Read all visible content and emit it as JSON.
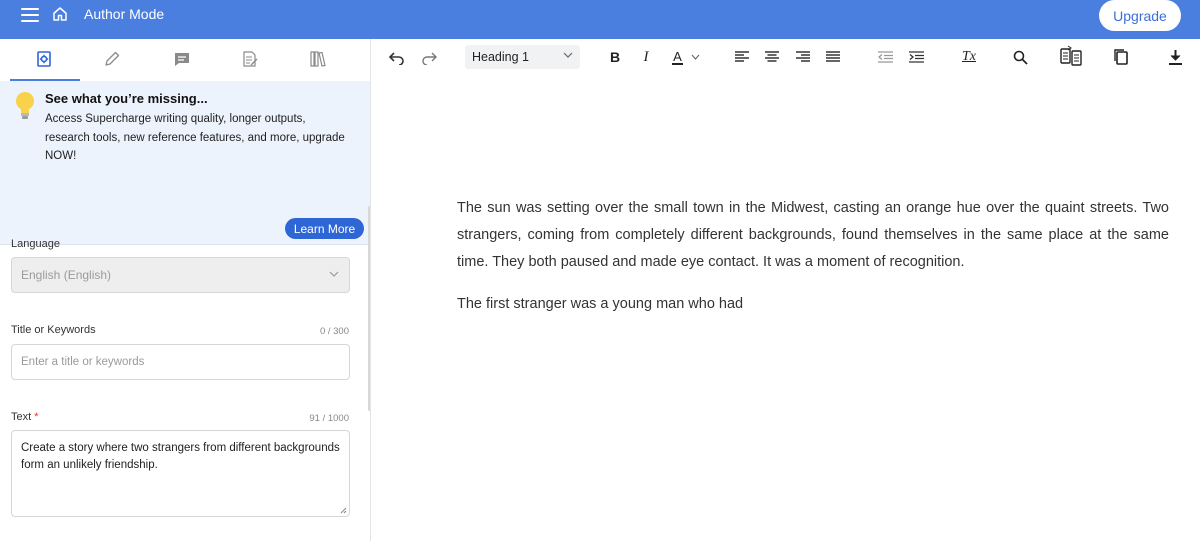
{
  "header": {
    "app_title": "Author Mode",
    "upgrade_label": "Upgrade",
    "bar_color": "#4a7fe0"
  },
  "left_tabs": [
    {
      "icon": "settings-doc-icon"
    },
    {
      "icon": "pencil-icon"
    },
    {
      "icon": "comment-icon"
    },
    {
      "icon": "document-edit-icon"
    },
    {
      "icon": "library-icon"
    }
  ],
  "promo": {
    "title": "See what you’re missing...",
    "body": "Access Supercharge writing quality, longer outputs, research tools, new reference features, and more, upgrade NOW!",
    "button_label": "Learn More"
  },
  "form": {
    "language": {
      "label": "Language",
      "value": "English (English)"
    },
    "title": {
      "label": "Title or Keywords",
      "counter": "0 / 300",
      "placeholder": "Enter a title or keywords",
      "value": ""
    },
    "text": {
      "label": "Text",
      "required_mark": "*",
      "counter": "91 / 1000",
      "value": "Create a story where two strangers from different backgrounds form an unlikely friendship."
    }
  },
  "toolbar": {
    "heading_value": "Heading 1",
    "bold": "B",
    "italic": "I",
    "font_color": "A",
    "clear_format": "Tx"
  },
  "document": {
    "paragraphs": [
      "The sun was setting over the small town in the Midwest, casting an orange hue over the quaint streets. Two strangers, coming from completely different backgrounds, found themselves in the same place at the same time. They both paused and made eye contact. It was a moment of recognition.",
      "The first stranger was a young man who had"
    ]
  }
}
